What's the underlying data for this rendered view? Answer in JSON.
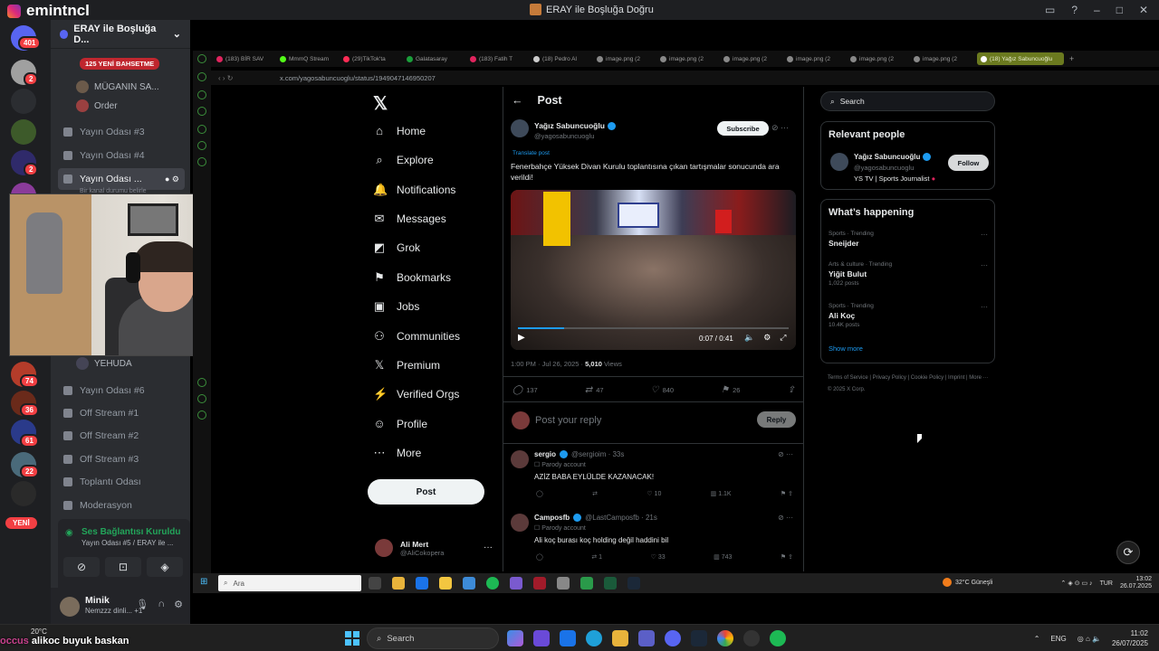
{
  "window": {
    "brand": "emintncl",
    "title": "ERAY ile Boşluğa Doğru"
  },
  "rail": {
    "badges": [
      "401",
      "2",
      "2",
      "74",
      "36",
      "61",
      "22"
    ],
    "new_label": "YENİ"
  },
  "discord": {
    "server_name": "ERAY ile Boşluğa D...",
    "tag": "125 YENİ BAHSETME",
    "users_top": [
      "MÜGANIN SA...",
      "Order"
    ],
    "channels": [
      "Yayın Odası #3",
      "Yayın Odası #4",
      "Yayın Odası ..."
    ],
    "active_sub": "Bir kanal durumu belirle",
    "user_mid": "YEHUDA",
    "channels_bottom": [
      "Yayın Odası #6",
      "Off Stream #1",
      "Off Stream #2",
      "Off Stream #3",
      "Toplantı Odası",
      "Moderasyon"
    ],
    "voice_status": "Ses Bağlantısı Kuruldu",
    "voice_sub": "Yayın Odası #5 / ERAY ile ...",
    "user_name": "Minik",
    "user_status": "Nemzzz dinli... +1"
  },
  "browser": {
    "tabs": [
      "(183) BİR SAV",
      "MmmQ Stream",
      "(29)TikTok'ta",
      "Galatasaray",
      "(183) Fatih T",
      "(18) Pedro Al",
      "image.png (2",
      "image.png (2",
      "image.png (2",
      "image.png (2",
      "image.png (2",
      "image.png (2",
      "(18) Yağız Sabuncuoğlu"
    ],
    "url": "x.com/yagosabuncuoglu/status/1949047146950207"
  },
  "x": {
    "nav": [
      {
        "icon": "home-icon",
        "glyph": "⌂",
        "label": "Home"
      },
      {
        "icon": "explore-icon",
        "glyph": "⌕",
        "label": "Explore"
      },
      {
        "icon": "bell-icon",
        "glyph": "🔔",
        "label": "Notifications"
      },
      {
        "icon": "mail-icon",
        "glyph": "✉",
        "label": "Messages"
      },
      {
        "icon": "grok-icon",
        "glyph": "◩",
        "label": "Grok"
      },
      {
        "icon": "bookmark-icon",
        "glyph": "⚑",
        "label": "Bookmarks"
      },
      {
        "icon": "jobs-icon",
        "glyph": "▣",
        "label": "Jobs"
      },
      {
        "icon": "communities-icon",
        "glyph": "⚇",
        "label": "Communities"
      },
      {
        "icon": "premium-icon",
        "glyph": "𝕏",
        "label": "Premium"
      },
      {
        "icon": "verified-icon",
        "glyph": "⚡",
        "label": "Verified Orgs"
      },
      {
        "icon": "profile-icon",
        "glyph": "☺",
        "label": "Profile"
      },
      {
        "icon": "more-icon",
        "glyph": "⋯",
        "label": "More"
      }
    ],
    "post_button": "Post",
    "account_name": "Ali Mert",
    "account_handle": "@AliCokopera",
    "header": "Post",
    "tweet": {
      "name": "Yağız Sabuncuoğlu",
      "handle": "@yagosabuncuoglu",
      "subscribe": "Subscribe",
      "translate": "Translate post",
      "text": "Fenerbahçe Yüksek Divan Kurulu toplantısına çıkan tartışmalar sonucunda ara verildi!",
      "video_time": "0:07 / 0:41",
      "video_progress": 0.17,
      "time": "1:00 PM · Jul 26, 2025 · ",
      "views": "5,010",
      "views_label": " Views",
      "replies": "137",
      "reposts": "47",
      "likes": "840",
      "bookmarks": "26"
    },
    "reply_placeholder": "Post your reply",
    "reply_button": "Reply",
    "replies": [
      {
        "name": "sergio",
        "handle": "@sergioim · 33s",
        "parody": "Parody account",
        "text": "AZİZ BABA EYLÜLDE KAZANACAK!",
        "r": "",
        "rt": "",
        "l": "10",
        "v": "1.1K"
      },
      {
        "name": "Camposfb",
        "handle": "@LastCamposfb · 21s",
        "parody": "Parody account",
        "text": "Ali koç burası koç holding değil haddini bil",
        "r": "",
        "rt": "1",
        "l": "33",
        "v": "743"
      }
    ],
    "search_placeholder": "Search",
    "relevant_title": "Relevant people",
    "relevant": {
      "name": "Yağız Sabuncuoğlu",
      "handle": "@yagosabuncuoglu",
      "bio": "YS TV | Sports Journalist",
      "follow": "Follow"
    },
    "happening_title": "What’s happening",
    "trends": [
      {
        "cat": "Sports · Trending",
        "title": "Sneijder",
        "posts": ""
      },
      {
        "cat": "Arts & culture · Trending",
        "title": "Yiğit Bulut",
        "posts": "1,022 posts"
      },
      {
        "cat": "Sports · Trending",
        "title": "Ali Koç",
        "posts": "10.4K posts"
      }
    ],
    "show_more": "Show more",
    "footer": "Terms of Service  |  Privacy Policy  |  Cookie Policy  |  Imprint  |  More ···  © 2025 X Corp."
  },
  "inner_taskbar": {
    "search": "Ara",
    "weather": "32°C  Güneşli",
    "lang": "TUR",
    "time": "13:02",
    "date": "26.07.2025"
  },
  "outer_taskbar": {
    "weather": "20°C",
    "overlay_prefix": "occus ",
    "overlay": "alikoc buyuk baskan",
    "search": "Search",
    "lang": "ENG",
    "time": "11:02",
    "date": "26/07/2025"
  }
}
